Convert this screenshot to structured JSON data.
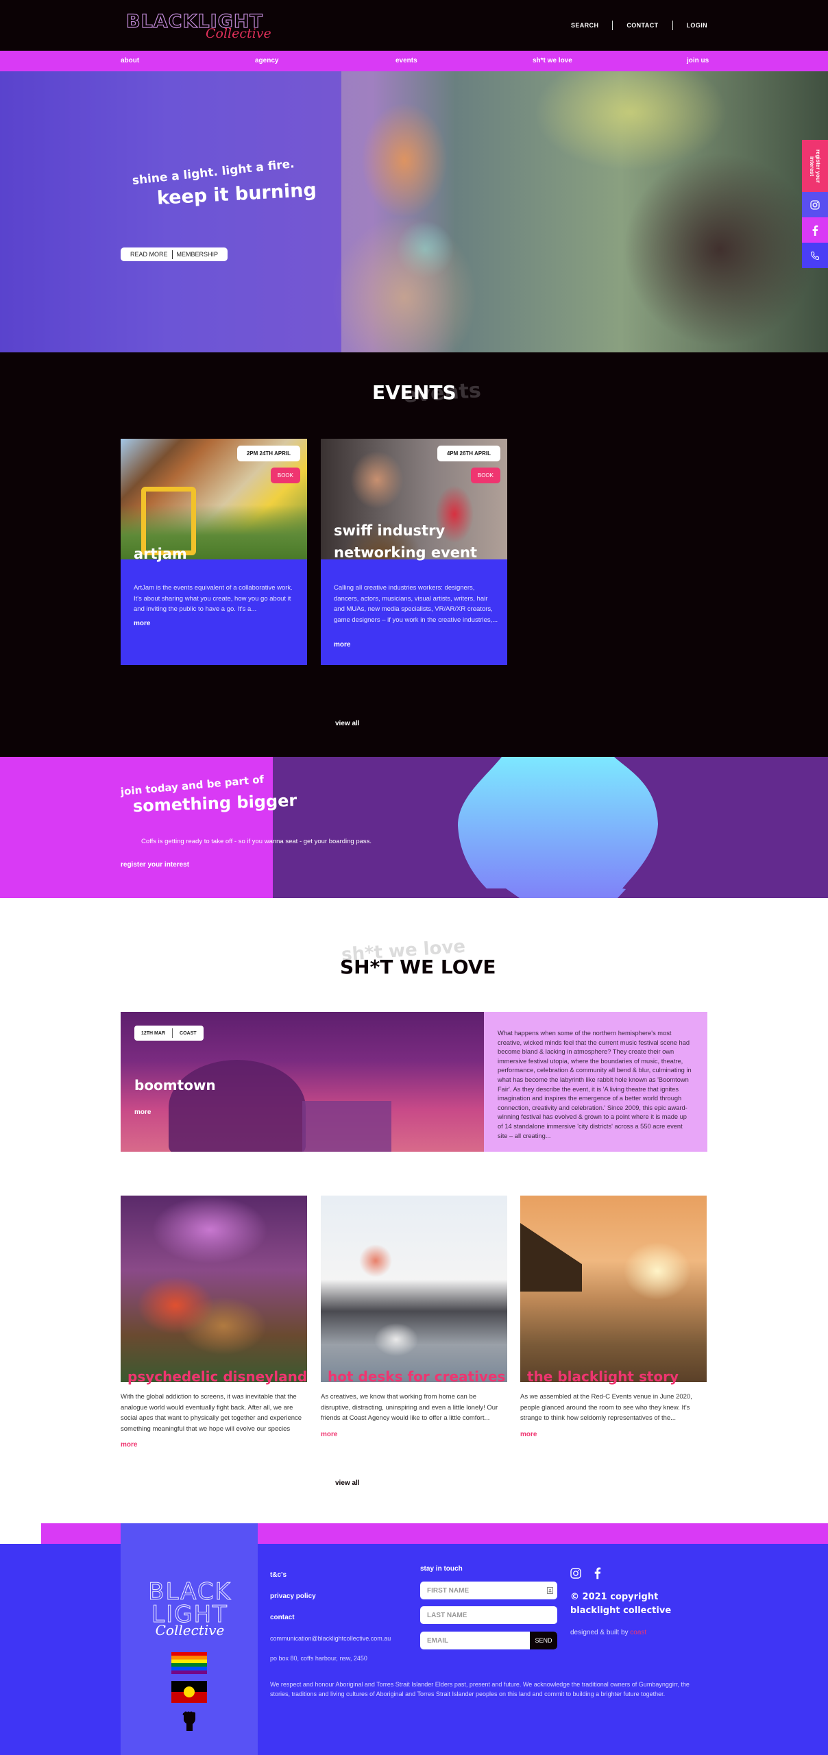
{
  "header": {
    "logo_main": "BLACKLIGHT",
    "logo_script": "Collective",
    "top_links": [
      "SEARCH",
      "CONTACT",
      "LOGIN"
    ]
  },
  "nav": {
    "items": [
      "about",
      "agency",
      "events",
      "sh*t we love",
      "join us"
    ]
  },
  "hero": {
    "line1": "shine a light. light a fire.",
    "line2": "keep it burning",
    "read_more": "READ MORE",
    "membership": "MEMBERSHIP"
  },
  "side_tabs": {
    "register": "register your interest",
    "icons": [
      "instagram-icon",
      "facebook-icon",
      "phone-icon"
    ]
  },
  "events": {
    "title": "EVENTS",
    "ghost": "events",
    "cards": [
      {
        "date": "2PM 24TH APRIL",
        "book": "BOOK",
        "title": "artjam",
        "description": "ArtJam is the events equivalent of a collaborative work. It's about sharing what you create, how you go about it and inviting the public to have a go. It's a...",
        "more": "more"
      },
      {
        "date": "4PM 26TH APRIL",
        "book": "BOOK",
        "title_line1": "swiff industry",
        "title_line2": "networking event",
        "description": "Calling all creative industries workers: designers, dancers, actors, musicians, visual artists, writers, hair and MUAs, new media specialists, VR/AR/XR creators, game designers – if you work in the creative industries,...",
        "more": "more"
      }
    ],
    "view_all": "view all"
  },
  "join": {
    "line1": "join today and be part of",
    "line2": "something bigger",
    "description": "Coffs is getting ready to take off - so if you wanna seat - get your boarding pass.",
    "cta": "register your interest"
  },
  "love": {
    "title": "SH*T WE LOVE",
    "ghost": "sh*t we love",
    "featured": {
      "date": "12TH MAR",
      "tag": "COAST",
      "title": "boomtown",
      "more": "more",
      "text": "What happens when some of the northern hemisphere's most creative, wicked minds feel that the current music festival scene had become bland & lacking in atmosphere? They create their own immersive festival utopia, where the boundaries of music, theatre, performance, celebration & community all bend & blur, culminating in what has become the labyrinth like rabbit hole known as 'Boomtown Fair'. As they describe the event, it is 'A living theatre that ignites imagination and inspires the emergence of a better world through connection, creativity and celebration.' Since 2009, this epic award-winning festival has evolved & grown to a point where it is made up of 14 standalone immersive 'city districts' across a 550 acre event site – all creating..."
    },
    "posts": [
      {
        "title": "psychedelic disneyland",
        "description": "With the global addiction to screens, it was inevitable that the analogue world would eventually fight back. After all, we are social apes that want to physically get together and experience something meaningful that we hope will evolve our species",
        "more": "more"
      },
      {
        "title": "hot desks for creatives",
        "description": "As creatives, we know that working from home can be disruptive, distracting, uninspiring and even a little lonely! Our friends at Coast Agency would like to offer a little comfort...",
        "more": "more"
      },
      {
        "title": "the blacklight story",
        "description": "As we assembled at the Red-C Events venue in June 2020, people glanced around the room to see who they knew. It's strange to think how seldomly representatives of the...",
        "more": "more"
      }
    ],
    "view_all": "view all"
  },
  "footer": {
    "logo_line1": "BLACK",
    "logo_line2": "LIGHT",
    "logo_script": "Collective",
    "links": [
      "t&c's",
      "privacy policy",
      "contact"
    ],
    "email": "communication@blacklightcollective.com.au",
    "address": "po box 80, coffs harbour, nsw, 2450",
    "stay_in_touch": "stay in touch",
    "first_name_placeholder": "FIRST NAME",
    "last_name_placeholder": "LAST NAME",
    "email_placeholder": "EMAIL",
    "send": "SEND",
    "copyright": "© 2021 copyright blacklight collective",
    "designed_by": "designed & built by ",
    "designer": "coast",
    "acknowledgement": "We respect and honour Aboriginal and Torres Strait Islander Elders past, present and future. We acknowledge the traditional owners of Gumbaynggirr, the stories, traditions and living cultures of Aboriginal and Torres Strait Islander peoples on this land and commit to building a brighter future together."
  },
  "colors": {
    "black": "#0b0205",
    "magenta": "#d93af5",
    "blue": "#3f35f5",
    "pink": "#ef3570",
    "purple": "#632a8e",
    "lilac": "#e8a6f8"
  }
}
